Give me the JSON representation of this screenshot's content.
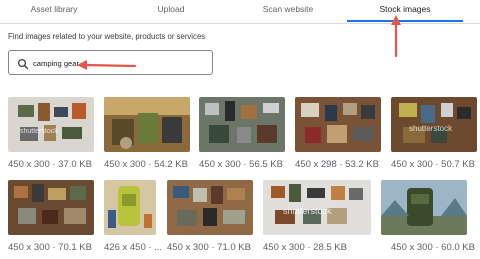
{
  "tabs": [
    {
      "label": "Asset library",
      "active": false
    },
    {
      "label": "Upload",
      "active": false
    },
    {
      "label": "Scan website",
      "active": false
    },
    {
      "label": "Stock images",
      "active": true
    }
  ],
  "hint": "Find images related to your website, products or services",
  "search": {
    "value": "camping gear",
    "icon": "search-icon"
  },
  "images": [
    {
      "caption": "450 x 300 · 37.0 KB",
      "bg": "#d9d6d0",
      "watermark": "shutterstock"
    },
    {
      "caption": "450 x 300 · 54.2 KB",
      "bg": "#8a6a3a",
      "watermark": ""
    },
    {
      "caption": "450 x 300 · 56.5 KB",
      "bg": "#6b7668",
      "watermark": ""
    },
    {
      "caption": "450 x 298 · 53.2 KB",
      "bg": "#7a5236",
      "watermark": ""
    },
    {
      "caption": "450 x 300 · 50.7 KB",
      "bg": "#6d4a2e",
      "watermark": "shutterstock"
    },
    {
      "caption": "450 x 300 · 70.1 KB",
      "bg": "#6a4a30",
      "watermark": ""
    },
    {
      "caption": "426 x 450 · ...",
      "bg": "#d5c6a4",
      "watermark": ""
    },
    {
      "caption": "450 x 300 · 71.0 KB",
      "bg": "#8f6a45",
      "watermark": ""
    },
    {
      "caption": "450 x 300 · 28.5 KB",
      "bg": "#e1dfdb",
      "watermark": "shutterstock"
    },
    {
      "caption": "450 x 300 · 60.0 KB",
      "bg": "#9db6c7",
      "watermark": ""
    }
  ],
  "colors": {
    "accent": "#1a73e8",
    "annotation": "#e2574c"
  }
}
